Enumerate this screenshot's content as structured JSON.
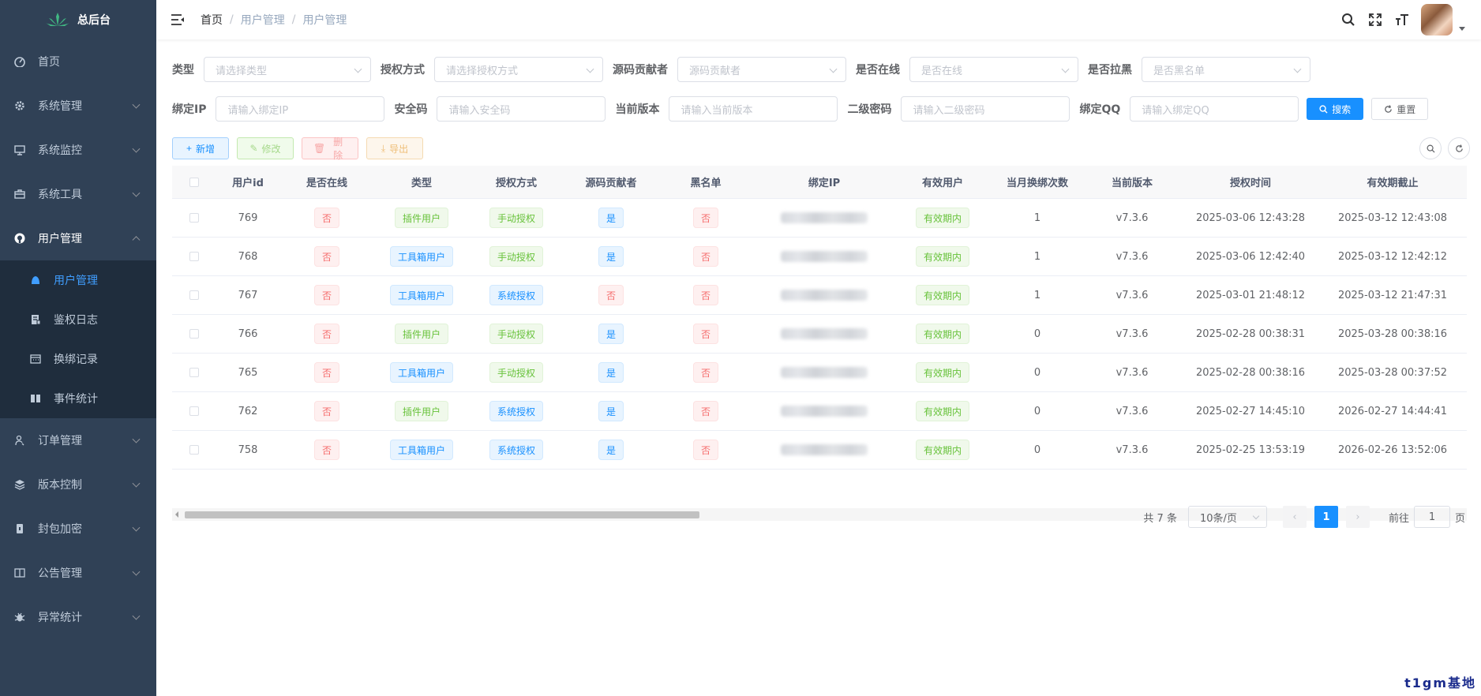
{
  "sidebar": {
    "logo_title": "总后台",
    "items": [
      {
        "label": "首页",
        "icon": "dashboard-icon"
      },
      {
        "label": "系统管理",
        "icon": "gear-icon"
      },
      {
        "label": "系统监控",
        "icon": "monitor-icon"
      },
      {
        "label": "系统工具",
        "icon": "toolbox-icon"
      },
      {
        "label": "用户管理",
        "icon": "github-icon"
      },
      {
        "label": "订单管理",
        "icon": "user-order-icon"
      },
      {
        "label": "版本控制",
        "icon": "layers-icon"
      },
      {
        "label": "封包加密",
        "icon": "lock-icon"
      },
      {
        "label": "公告管理",
        "icon": "book-icon"
      },
      {
        "label": "异常统计",
        "icon": "bug-icon"
      }
    ],
    "sub_items": [
      {
        "label": "用户管理",
        "icon": "bell-user-icon"
      },
      {
        "label": "鉴权日志",
        "icon": "log-icon"
      },
      {
        "label": "换绑记录",
        "icon": "calendar-icon"
      },
      {
        "label": "事件统计",
        "icon": "book-open-icon"
      }
    ]
  },
  "header": {
    "breadcrumb": [
      "首页",
      "用户管理",
      "用户管理"
    ]
  },
  "filters": {
    "type_label": "类型",
    "type_placeholder": "请选择类型",
    "auth_label": "授权方式",
    "auth_placeholder": "请选择授权方式",
    "contrib_label": "源码贡献者",
    "contrib_placeholder": "源码贡献者",
    "online_label": "是否在线",
    "online_placeholder": "是否在线",
    "black_label": "是否拉黑",
    "black_placeholder": "是否黑名单",
    "ip_label": "绑定IP",
    "ip_placeholder": "请输入绑定IP",
    "code_label": "安全码",
    "code_placeholder": "请输入安全码",
    "ver_label": "当前版本",
    "ver_placeholder": "请输入当前版本",
    "pwd_label": "二级密码",
    "pwd_placeholder": "请输入二级密码",
    "qq_label": "绑定QQ",
    "qq_placeholder": "请输入绑定QQ",
    "search_btn": "搜索",
    "reset_btn": "重置"
  },
  "toolbar": {
    "add": "新增",
    "edit": "修改",
    "delete": "删除",
    "export": "导出"
  },
  "table": {
    "columns": [
      "用户id",
      "是否在线",
      "类型",
      "授权方式",
      "源码贡献者",
      "黑名单",
      "绑定IP",
      "有效用户",
      "当月换绑次数",
      "当前版本",
      "授权时间",
      "有效期截止"
    ],
    "rows": [
      {
        "id": "769",
        "online": "否",
        "type": "插件用户",
        "type_kind": "success",
        "auth": "手动授权",
        "auth_kind": "success",
        "contrib": "是",
        "contrib_kind": "primary",
        "black": "否",
        "valid": "有效期内",
        "swaps": "1",
        "version": "v7.3.6",
        "auth_time": "2025-03-06 12:43:28",
        "expire": "2025-03-12 12:43:08"
      },
      {
        "id": "768",
        "online": "否",
        "type": "工具箱用户",
        "type_kind": "primary",
        "auth": "手动授权",
        "auth_kind": "success",
        "contrib": "是",
        "contrib_kind": "primary",
        "black": "否",
        "valid": "有效期内",
        "swaps": "1",
        "version": "v7.3.6",
        "auth_time": "2025-03-06 12:42:40",
        "expire": "2025-03-12 12:42:12"
      },
      {
        "id": "767",
        "online": "否",
        "type": "工具箱用户",
        "type_kind": "primary",
        "auth": "系统授权",
        "auth_kind": "primary",
        "contrib": "否",
        "contrib_kind": "danger",
        "black": "否",
        "valid": "有效期内",
        "swaps": "1",
        "version": "v7.3.6",
        "auth_time": "2025-03-01 21:48:12",
        "expire": "2025-03-12 21:47:31"
      },
      {
        "id": "766",
        "online": "否",
        "type": "插件用户",
        "type_kind": "success",
        "auth": "手动授权",
        "auth_kind": "success",
        "contrib": "是",
        "contrib_kind": "primary",
        "black": "否",
        "valid": "有效期内",
        "swaps": "0",
        "version": "v7.3.6",
        "auth_time": "2025-02-28 00:38:31",
        "expire": "2025-03-28 00:38:16"
      },
      {
        "id": "765",
        "online": "否",
        "type": "工具箱用户",
        "type_kind": "primary",
        "auth": "手动授权",
        "auth_kind": "success",
        "contrib": "是",
        "contrib_kind": "primary",
        "black": "否",
        "valid": "有效期内",
        "swaps": "0",
        "version": "v7.3.6",
        "auth_time": "2025-02-28 00:38:16",
        "expire": "2025-03-28 00:37:52"
      },
      {
        "id": "762",
        "online": "否",
        "type": "插件用户",
        "type_kind": "success",
        "auth": "系统授权",
        "auth_kind": "primary",
        "contrib": "是",
        "contrib_kind": "primary",
        "black": "否",
        "valid": "有效期内",
        "swaps": "0",
        "version": "v7.3.6",
        "auth_time": "2025-02-27 14:45:10",
        "expire": "2026-02-27 14:44:41"
      },
      {
        "id": "758",
        "online": "否",
        "type": "工具箱用户",
        "type_kind": "primary",
        "auth": "系统授权",
        "auth_kind": "primary",
        "contrib": "是",
        "contrib_kind": "primary",
        "black": "否",
        "valid": "有效期内",
        "swaps": "0",
        "version": "v7.3.6",
        "auth_time": "2025-02-25 13:53:19",
        "expire": "2026-02-26 13:52:06"
      }
    ]
  },
  "pagination": {
    "total": "共 7 条",
    "page_size": "10条/页",
    "current": "1",
    "goto_label": "前往",
    "goto_value": "1",
    "page_suffix": "页"
  },
  "watermark": "t1gm基地"
}
